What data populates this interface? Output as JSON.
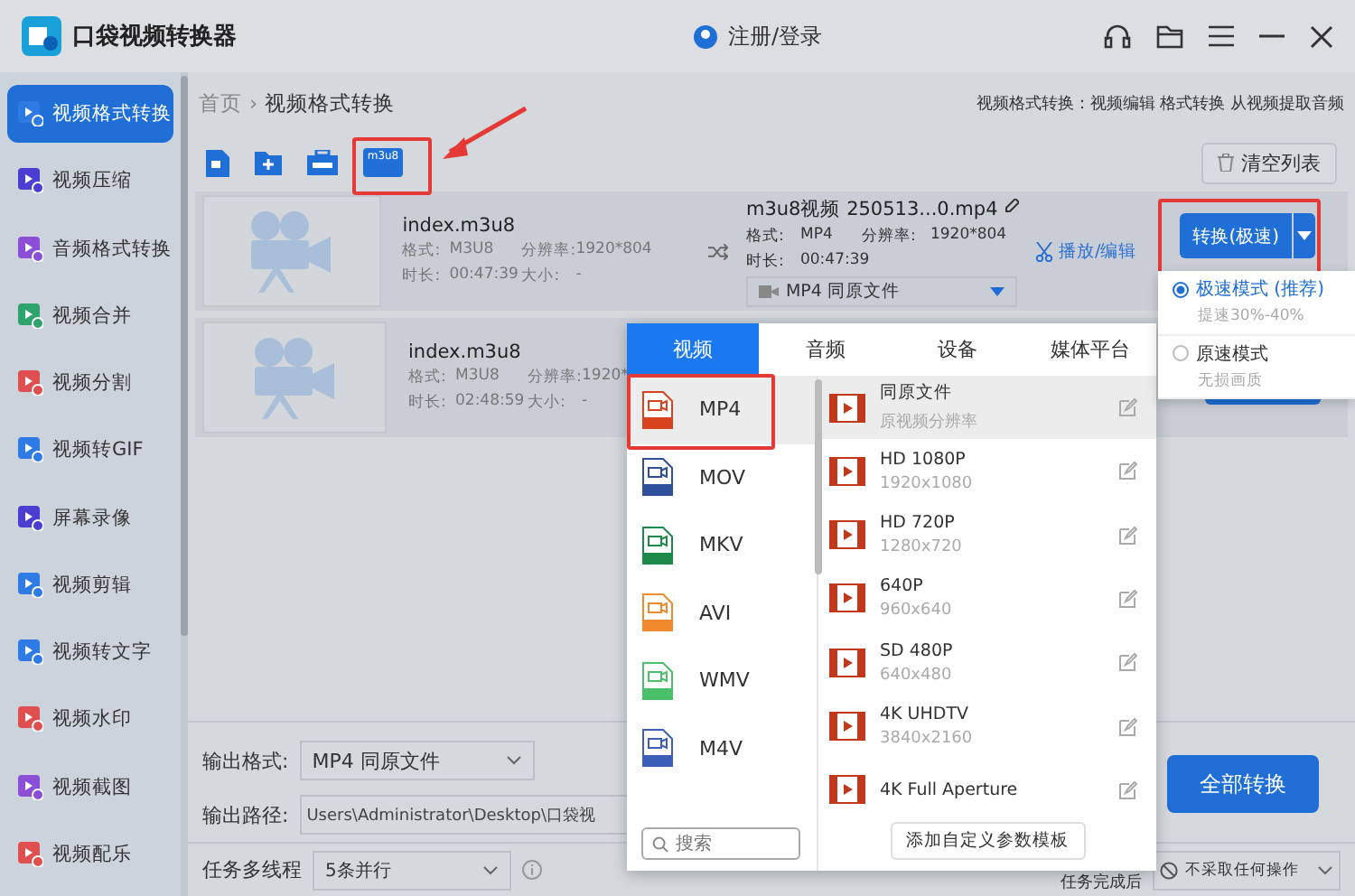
{
  "window": {
    "title": "口袋视频转换器",
    "account": "注册/登录"
  },
  "sidebar": {
    "items": [
      {
        "label": "视频格式转换",
        "selected": true,
        "color": "#2f7be6"
      },
      {
        "label": "视频压缩",
        "selected": false,
        "color": "#4b3fd1"
      },
      {
        "label": "音频格式转换",
        "selected": false,
        "color": "#8a4fd6"
      },
      {
        "label": "视频合并",
        "selected": false,
        "color": "#2ea36b"
      },
      {
        "label": "视频分割",
        "selected": false,
        "color": "#e04f4f"
      },
      {
        "label": "视频转GIF",
        "selected": false,
        "color": "#2f7be6"
      },
      {
        "label": "屏幕录像",
        "selected": false,
        "color": "#4b3fd1"
      },
      {
        "label": "视频剪辑",
        "selected": false,
        "color": "#2f7be6"
      },
      {
        "label": "视频转文字",
        "selected": false,
        "color": "#2f7be6"
      },
      {
        "label": "视频水印",
        "selected": false,
        "color": "#e04f4f"
      },
      {
        "label": "视频截图",
        "selected": false,
        "color": "#8a4fd6"
      },
      {
        "label": "视频配乐",
        "selected": false,
        "color": "#e04f4f"
      }
    ]
  },
  "breadcrumb": {
    "items": [
      "首页",
      "视频格式转换"
    ],
    "separator": "›",
    "hint": "视频格式转换：视频编辑 格式转换 从视频提取音频"
  },
  "toolbar": {
    "tools": [
      {
        "kind": "file"
      },
      {
        "kind": "folder"
      },
      {
        "kind": "batch"
      },
      {
        "kind": "m3u8",
        "label": "m3u8"
      }
    ],
    "clear": "清空列表"
  },
  "files": [
    {
      "name": "index.m3u8",
      "fields": [
        [
          "格式:",
          "M3U8"
        ],
        [
          "分辨率:",
          "1920*804"
        ],
        [
          "时长:",
          "00:47:39"
        ],
        [
          "大小:",
          "-"
        ]
      ],
      "output": {
        "name": "m3u8视频 250513...0.mp4",
        "fields": [
          [
            "格式:",
            "MP4"
          ],
          [
            "分辨率:",
            "1920*804"
          ],
          [
            "时长:",
            "00:47:39"
          ]
        ],
        "preset": "MP4  同原文件",
        "edit": "播放/编辑",
        "convert": "转换(极速)"
      }
    },
    {
      "name": "index.m3u8",
      "fields": [
        [
          "格式:",
          "M3U8"
        ],
        [
          "分辨率:",
          "1920*"
        ],
        [
          "时长:",
          "02:48:59"
        ],
        [
          "大小:",
          "-"
        ]
      ]
    }
  ],
  "format_popover": {
    "tabs": [
      {
        "label": "视频",
        "selected": true
      },
      {
        "label": "音频",
        "selected": false
      },
      {
        "label": "设备",
        "selected": false
      },
      {
        "label": "媒体平台",
        "selected": false
      }
    ],
    "formats": [
      {
        "label": "MP4",
        "selected": true,
        "color": "#d9441f"
      },
      {
        "label": "MOV",
        "selected": false,
        "color": "#2d4f9c"
      },
      {
        "label": "MKV",
        "selected": false,
        "color": "#1e8a4a"
      },
      {
        "label": "AVI",
        "selected": false,
        "color": "#f08a2c"
      },
      {
        "label": "WMV",
        "selected": false,
        "color": "#4cbf6a"
      },
      {
        "label": "M4V",
        "selected": false,
        "color": "#3b5fb8"
      }
    ],
    "presets": [
      {
        "title": "同原文件",
        "subtitle": "原视频分辨率",
        "selected": true
      },
      {
        "title": "HD 1080P",
        "subtitle": "1920x1080",
        "selected": false
      },
      {
        "title": "HD 720P",
        "subtitle": "1280x720",
        "selected": false
      },
      {
        "title": "640P",
        "subtitle": "960x640",
        "selected": false
      },
      {
        "title": "SD 480P",
        "subtitle": "640x480",
        "selected": false
      },
      {
        "title": "4K UHDTV",
        "subtitle": "3840x2160",
        "selected": false
      },
      {
        "title": "4K Full Aperture",
        "selected": false
      }
    ],
    "search": {
      "placeholder": "搜索"
    },
    "add_template": "添加自定义参数模板"
  },
  "speed_menu": {
    "options": [
      {
        "label": "极速模式 (推荐)",
        "note": "提速30%-40%",
        "selected": true
      },
      {
        "label": "原速模式",
        "note": "无损画质",
        "selected": false
      }
    ]
  },
  "bottom": {
    "format_label": "输出格式:",
    "format_value": "MP4  同原文件",
    "path_label": "输出路径:",
    "path_value": "Users\\Administrator\\Desktop\\口袋视",
    "convert_all": "全部转换",
    "threads_label": "任务多线程",
    "threads_value": "5条并行",
    "after_label": "任务完成后",
    "after_value": "不采取任何操作"
  }
}
